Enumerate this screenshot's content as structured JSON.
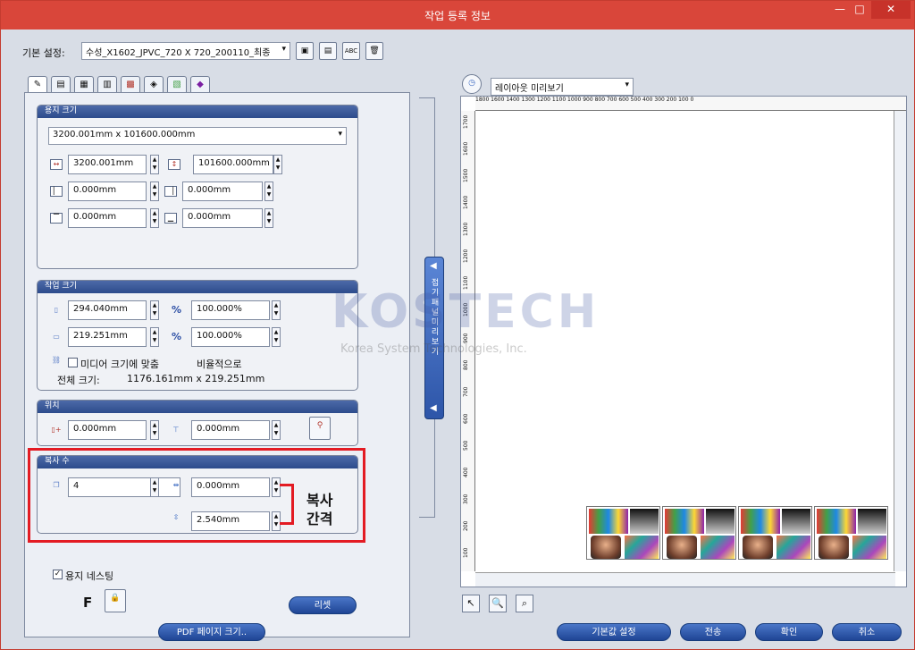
{
  "window": {
    "title": "작업 등록 정보",
    "min_label": "—",
    "max_label": "□",
    "close_label": "✕"
  },
  "preset": {
    "label": "기본 설정:",
    "value": "수성_X1602_JPVC_720 X 720_200110_최종",
    "buttons": [
      "save-icon",
      "save-as-icon",
      "rename-icon",
      "delete-icon"
    ]
  },
  "tabs": [
    "tab-1",
    "tab-2",
    "tab-3",
    "tab-4",
    "tab-5",
    "tab-6",
    "tab-7",
    "tab-8"
  ],
  "media_size": {
    "header": "용지 크기",
    "dropdown_value": "3200.001mm x 101600.000mm",
    "width": "3200.001mm",
    "height": "101600.000mm",
    "margin_left": "0.000mm",
    "margin_right": "0.000mm",
    "margin_top": "0.000mm",
    "margin_bottom": "0.000mm"
  },
  "job_size": {
    "header": "작업 크기",
    "height": "294.040mm",
    "height_pct": "100.000%",
    "width": "219.251mm",
    "width_pct": "100.000%",
    "percent_symbol": "%",
    "fit_media_label": "미디어 크기에 맞춤",
    "proportional_label": "비율적으로",
    "total_size_label": "전체 크기:",
    "total_size_value": "1176.161mm x 219.251mm"
  },
  "position": {
    "header": "위치",
    "x": "0.000mm",
    "y": "0.000mm"
  },
  "copies": {
    "header": "복사 수",
    "count": "4",
    "h_spacing": "0.000mm",
    "v_spacing": "2.540mm",
    "annotation_line1": "복사",
    "annotation_line2": "간격"
  },
  "nesting": {
    "label": "용지 네스팅",
    "checked": true,
    "f_label": "F"
  },
  "buttons": {
    "reset": "리셋",
    "pdf_page_size": "PDF 페이지 크기..",
    "save_default": "기본값 설정",
    "send": "전송",
    "ok": "확인",
    "cancel": "취소"
  },
  "collapse_panel": {
    "label": "접기 패널 미리보기"
  },
  "preview": {
    "mode": "레이아웃 미리보기",
    "ruler_top": "1800 1600 1400 1300 1200 1100 1000 900 800 700 600 500 400 300 200 100 0",
    "ruler_left": [
      "100",
      "200",
      "300",
      "400",
      "500",
      "600",
      "700",
      "800",
      "900",
      "1000",
      "1100",
      "1200",
      "1300",
      "1400",
      "1500",
      "1600",
      "1700"
    ],
    "copy_count": 4
  },
  "watermark": {
    "brand": "KOSTECH",
    "subtitle": "Korea System Technologies, Inc."
  }
}
